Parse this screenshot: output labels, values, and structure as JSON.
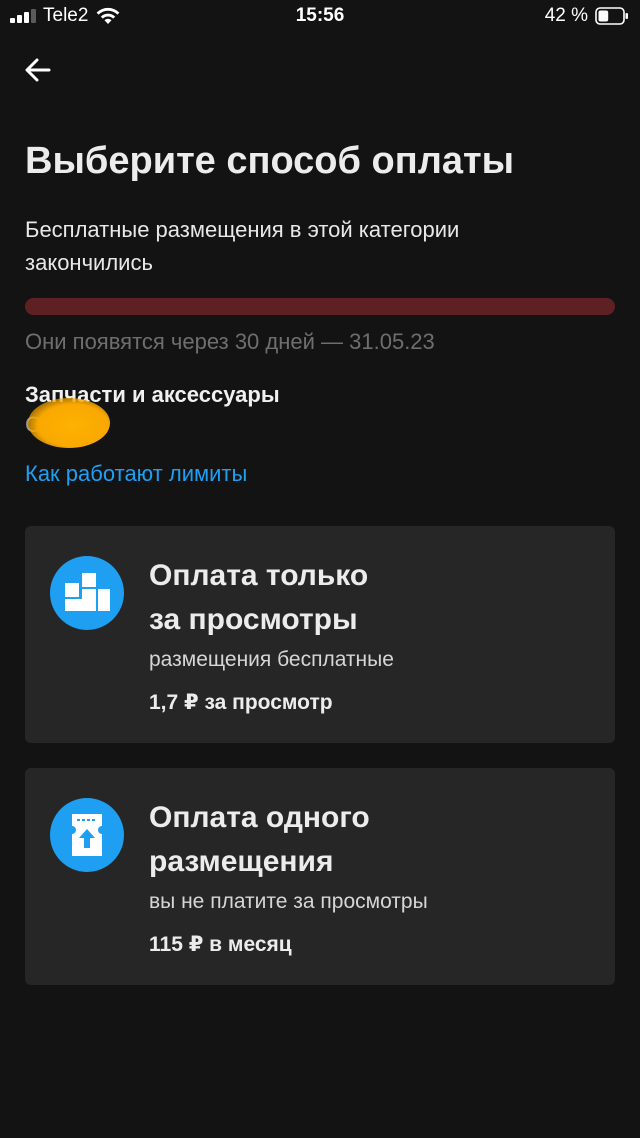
{
  "status_bar": {
    "carrier": "Tele2",
    "time": "15:56",
    "battery_percent": "42 %",
    "battery_level": 0.42,
    "signal_bars_active": 3,
    "signal_bars_total": 4
  },
  "header": {
    "back_icon": "arrow-left-icon"
  },
  "page": {
    "title": "Выберите способ оплаты",
    "subtitle": "Бесплатные размещения в этой категории закончились",
    "quota_used_fraction": 1.0,
    "reset_note": "Они появятся через 30 дней — 31.05.23",
    "category_name": "Запчасти и аксессуары",
    "category_detail": "С",
    "limits_link": "Как работают лимиты"
  },
  "options": [
    {
      "icon": "boxes-icon",
      "title_line1": "Оплата только",
      "title_line2": "за просмотры",
      "description": "размещения бесплатные",
      "price": "1,7 ₽ за просмотр"
    },
    {
      "icon": "ticket-up-icon",
      "title_line1": "Оплата одного",
      "title_line2": "размещения",
      "description": "вы не платите за просмотры",
      "price": "115 ₽ в месяц"
    }
  ],
  "colors": {
    "background": "#131313",
    "card": "#262626",
    "accent_blue": "#1e9ff2",
    "link_blue": "#1e9ff2",
    "progress_bar": "#5e2023",
    "redaction": "#f9a800"
  }
}
